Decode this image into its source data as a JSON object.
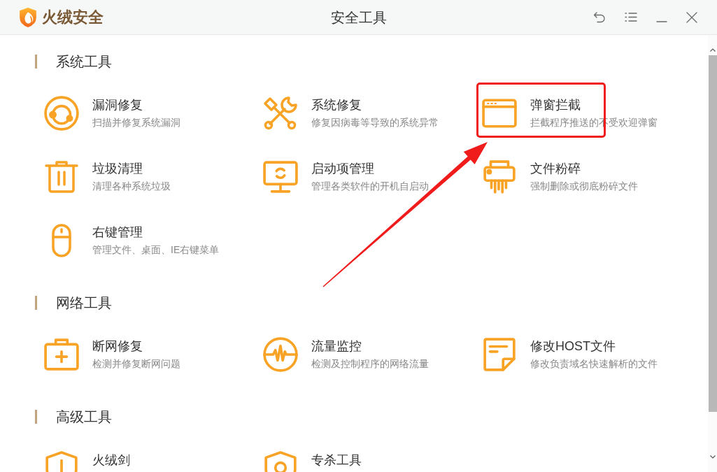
{
  "titlebar": {
    "brand": "火绒安全",
    "title": "安全工具"
  },
  "sections": [
    {
      "title": "系统工具",
      "items": [
        {
          "title": "漏洞修复",
          "description": "扫描并修复系统漏洞",
          "highlighted": false
        },
        {
          "title": "系统修复",
          "description": "修复因病毒等导致的系统异常",
          "highlighted": false
        },
        {
          "title": "弹窗拦截",
          "description": "拦截程序推送的不受欢迎弹窗",
          "highlighted": true
        },
        {
          "title": "垃圾清理",
          "description": "清理各种系统垃圾",
          "highlighted": false
        },
        {
          "title": "启动项管理",
          "description": "管理各类软件的开机自启动",
          "highlighted": false
        },
        {
          "title": "文件粉碎",
          "description": "强制删除或彻底粉碎文件",
          "highlighted": false
        },
        {
          "title": "右键管理",
          "description": "管理文件、桌面、IE右键菜单",
          "highlighted": false
        }
      ]
    },
    {
      "title": "网络工具",
      "items": [
        {
          "title": "断网修复",
          "description": "检测并修复断网问题",
          "highlighted": false
        },
        {
          "title": "流量监控",
          "description": "检测及控制程序的网络流量",
          "highlighted": false
        },
        {
          "title": "修改HOST文件",
          "description": "修改负责域名快速解析的文件",
          "highlighted": false
        }
      ]
    },
    {
      "title": "高级工具",
      "items": [
        {
          "title": "火绒剑",
          "highlighted": false
        },
        {
          "title": "专杀工具",
          "highlighted": false
        }
      ]
    }
  ]
}
